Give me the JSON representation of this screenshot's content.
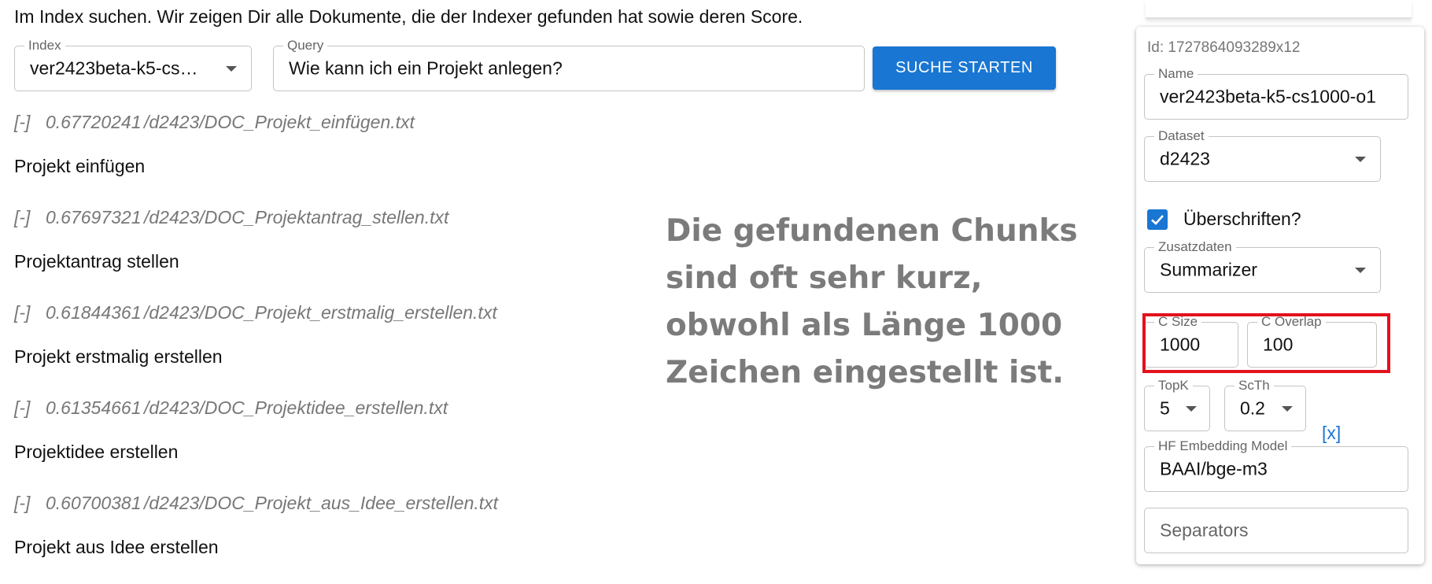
{
  "intro_text": "Im Index suchen. Wir zeigen Dir alle Dokumente, die der Indexer gefunden hat sowie deren Score.",
  "search": {
    "index_label": "Index",
    "index_value": "ver2423beta-k5-cs…",
    "query_label": "Query",
    "query_value": "Wie kann ich ein Projekt anlegen?",
    "button_label": "SUCHE STARTEN"
  },
  "results": [
    {
      "toggle": "[-]",
      "score": "0.67720241",
      "path": "/d2423/DOC_Projekt_einfügen.txt",
      "title": "Projekt einfügen"
    },
    {
      "toggle": "[-]",
      "score": "0.67697321",
      "path": "/d2423/DOC_Projektantrag_stellen.txt",
      "title": "Projektantrag stellen"
    },
    {
      "toggle": "[-]",
      "score": "0.61844361",
      "path": "/d2423/DOC_Projekt_erstmalig_erstellen.txt",
      "title": "Projekt erstmalig erstellen"
    },
    {
      "toggle": "[-]",
      "score": "0.61354661",
      "path": "/d2423/DOC_Projektidee_erstellen.txt",
      "title": "Projektidee erstellen"
    },
    {
      "toggle": "[-]",
      "score": "0.60700381",
      "path": "/d2423/DOC_Projekt_aus_Idee_erstellen.txt",
      "title": "Projekt aus Idee erstellen"
    }
  ],
  "annotation": "Die gefundenen Chunks\nsind oft sehr kurz,\nobwohl als Länge 1000\nZeichen eingestellt ist.",
  "config": {
    "id_text": "Id: 1727864093289x12",
    "name_label": "Name",
    "name_value": "ver2423beta-k5-cs1000-o1",
    "dataset_label": "Dataset",
    "dataset_value": "d2423",
    "headings_label": "Überschriften?",
    "headings_checked": true,
    "extra_label": "Zusatzdaten",
    "extra_value": "Summarizer",
    "csize_label": "C Size",
    "csize_value": "1000",
    "coverlap_label": "C Overlap",
    "coverlap_value": "100",
    "topk_label": "TopK",
    "topk_value": "5",
    "scth_label": "ScTh",
    "scth_value": "0.2",
    "clear_label": "[x]",
    "embedding_label": "HF Embedding Model",
    "embedding_value": "BAAI/bge-m3",
    "separators_placeholder": "Separators"
  },
  "colors": {
    "primary": "#1976d2",
    "highlight": "#e3121b",
    "annotation": "#7b7b7b"
  }
}
